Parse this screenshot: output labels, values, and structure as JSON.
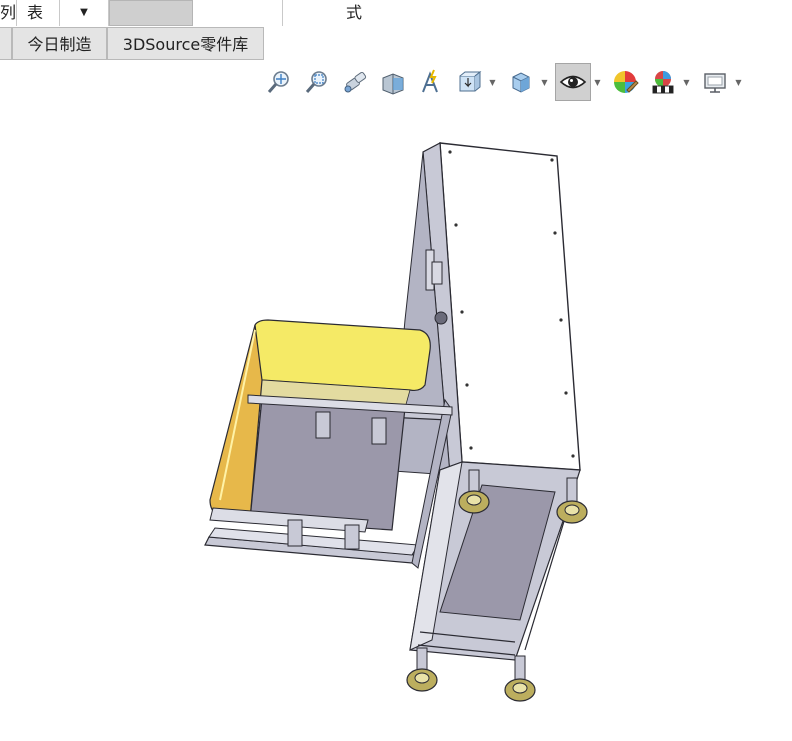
{
  "top_bar": {
    "cells": [
      "列",
      "表",
      "式"
    ],
    "dropdown_arrow": "▼"
  },
  "tabs": [
    "今日制造",
    "3DSource零件库"
  ],
  "heads_up_toolbar": {
    "icons": [
      "zoom-to-fit-icon",
      "zoom-to-area-icon",
      "previous-view-icon",
      "section-view-icon",
      "dynamic-annotation-view-icon",
      "view-orientation-icon",
      "display-style-icon",
      "hide-show-items-icon",
      "edit-appearance-icon",
      "apply-scene-icon",
      "view-settings-icon"
    ],
    "active_icon": "hide-show-items-icon"
  },
  "model": {
    "description_colors": {
      "frame": "#c8c9d6",
      "frame_edge": "#2b2b33",
      "panel": "#ffffff",
      "seat_fabric": "#f5ea66",
      "seat_shade": "#e7b84a",
      "seat_base": "#9b98aa",
      "caster": "#bcae5e"
    }
  },
  "colors": {
    "tab_bg": "#e4e4e4",
    "active_button_bg": "#d0d0d0",
    "border": "#b9b9b9"
  }
}
